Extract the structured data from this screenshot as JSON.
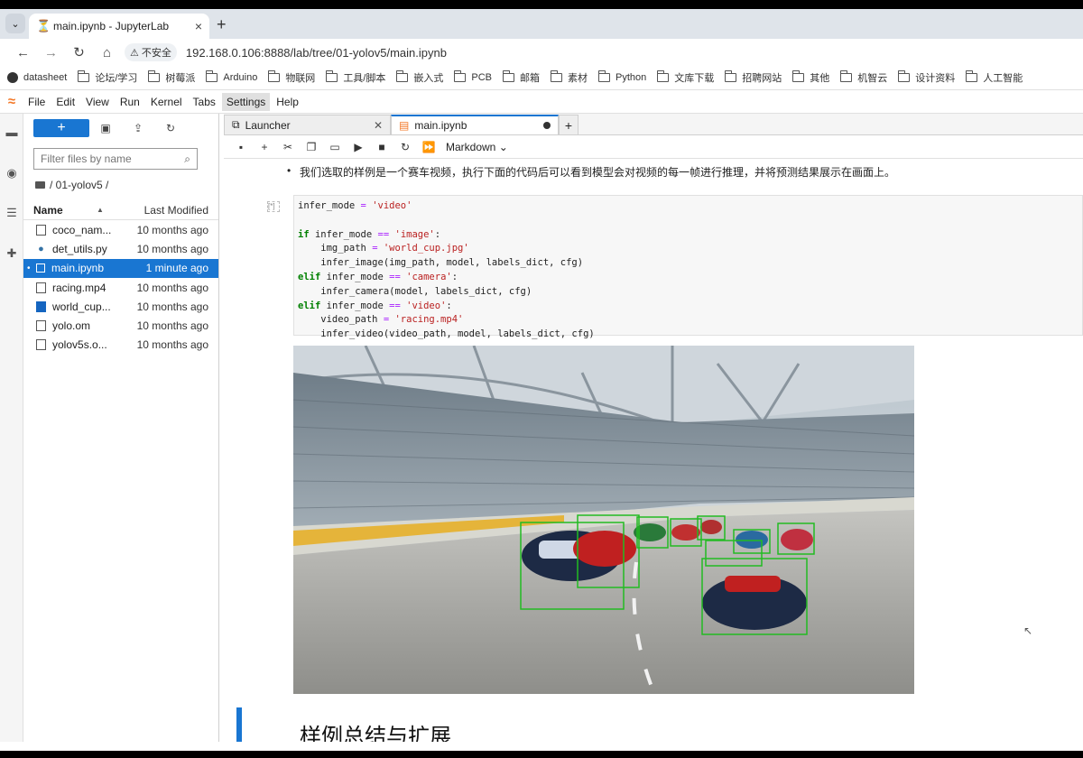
{
  "browser": {
    "tab_title": "main.ipynb - JupyterLab",
    "address": {
      "security_label": "不安全",
      "url": "192.168.0.106:8888/lab/tree/01-yolov5/main.ipynb"
    },
    "bookmarks": [
      "datasheet",
      "论坛/学习",
      "树莓派",
      "Arduino",
      "物联网",
      "工具/脚本",
      "嵌入式",
      "PCB",
      "邮箱",
      "素材",
      "Python",
      "文库下载",
      "招聘网站",
      "其他",
      "机智云",
      "设计资料",
      "人工智能"
    ]
  },
  "menubar": [
    "File",
    "Edit",
    "View",
    "Run",
    "Kernel",
    "Tabs",
    "Settings",
    "Help"
  ],
  "filebrowser": {
    "new_label": "+",
    "search_placeholder": "Filter files by name",
    "breadcrumb": "/ 01-yolov5 /",
    "col_name": "Name",
    "col_modified": "Last Modified",
    "files": [
      {
        "name": "coco_nam...",
        "modified": "10 months ago"
      },
      {
        "name": "det_utils.py",
        "modified": "10 months ago"
      },
      {
        "name": "main.ipynb",
        "modified": "1 minute ago"
      },
      {
        "name": "racing.mp4",
        "modified": "10 months ago"
      },
      {
        "name": "world_cup...",
        "modified": "10 months ago"
      },
      {
        "name": "yolo.om",
        "modified": "10 months ago"
      },
      {
        "name": "yolov5s.o...",
        "modified": "10 months ago"
      }
    ]
  },
  "dock": {
    "tab_launcher": "Launcher",
    "tab_main": "main.ipynb"
  },
  "notebook": {
    "cell_type": "Markdown",
    "markdown_bullet": "我们选取的样例是一个赛车视频，执行下面的代码后可以看到模型会对视频的每一帧进行推理，并将预测结果展示在画面上。",
    "heading": "样例总结与扩展"
  },
  "colors": {
    "accent": "#1976d2",
    "jupyter_orange": "#f37726",
    "detection_box": "#22bb22"
  }
}
